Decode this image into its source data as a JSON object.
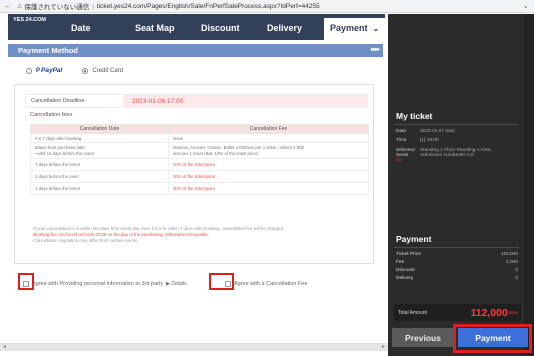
{
  "browser": {
    "security_text": "保護されていない通信",
    "url": "ticket.yes24.com/Pages/English/Sale/FnPerfSaleProcess.aspx?IdPerf=44255"
  },
  "site": {
    "logo": "YES 24.COM",
    "steps": [
      "Date",
      "Seat Map",
      "Discount",
      "Delivery",
      "Payment"
    ]
  },
  "payment_method": {
    "title": "Payment Method",
    "paypal_label": "PayPal",
    "credit_card_label": "Credit Card"
  },
  "cancellation": {
    "deadline_label": "Cancellation Deadline",
    "deadline_value": "2023-01-06 17:00",
    "fees_title": "Cancellation fees",
    "table_headers": [
      "Cancellation Date",
      "Cancellation Fee"
    ],
    "rows": [
      [
        "For 7 days after booking",
        "None"
      ],
      [
        "8days from purchase date\n~until 10 days before the event",
        "Musical, Concert, Classic, Ballet 4,000won per 1 ticket / others 2,000\nwon per 1 ticket (But, 10% of the ticket price)"
      ],
      [
        "7 days before the event",
        "10% of the ticket price"
      ],
      [
        "3 days before the even",
        "20% of the ticket price"
      ],
      [
        "1 days before the event",
        "30% of the ticket price"
      ]
    ],
    "notes": [
      "-If your cancellation is in within ten days from event day even if it is in within 7 days after booking, cancellation fee will be charged.",
      "-Booking fee can be refund until 23:59 on the day of the purchasing. Otherwise irrevocable.",
      "-Cancellation regulation may differ from certain events."
    ]
  },
  "agree": {
    "third_party": "Agree with Providing personal information to 3rd party",
    "details": "▶ Details",
    "cancel_fee": "Agree with a Cancellation Fee"
  },
  "my_ticket": {
    "title": "My ticket",
    "date_k": "Date",
    "date_v": "2023.01.07 (sat)",
    "time_k": "Time",
    "time_v": "[1] 18:00",
    "seats_k1": "Selected",
    "seats_k2": "Seats",
    "seats_count": "(1)",
    "seats_v1": "Standing 1 Floor Standing A Area",
    "seats_v2": "Admission number60 Col"
  },
  "payment": {
    "title": "Payment",
    "rows": [
      [
        "Ticket Price",
        "110,000"
      ],
      [
        "Fee",
        "2,000"
      ],
      [
        "Discount",
        "0"
      ],
      [
        "Delivery",
        "0"
      ]
    ],
    "total_label": "Total Amount",
    "total_value": "112,000",
    "total_unit": "Won"
  },
  "buttons": {
    "previous": "Previous",
    "payment": "Payment"
  }
}
